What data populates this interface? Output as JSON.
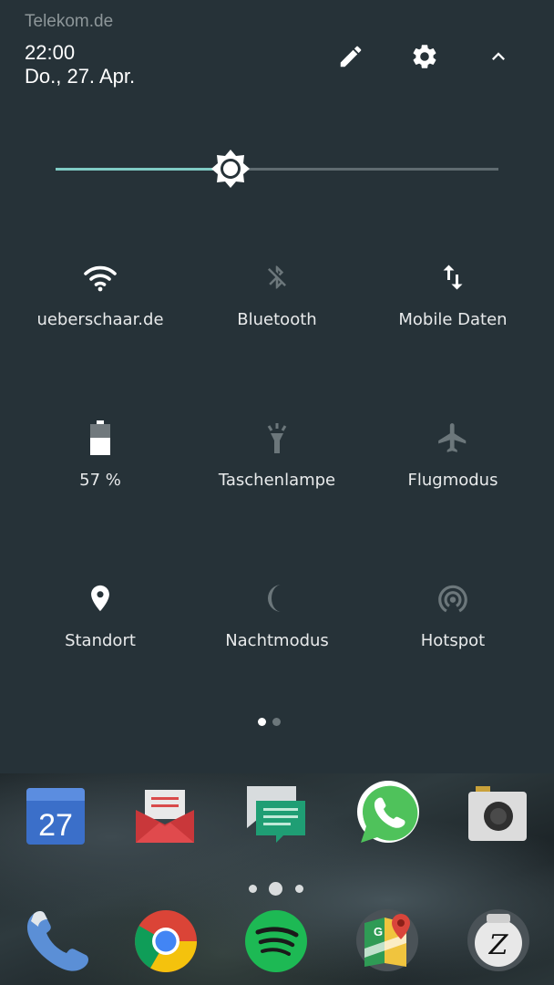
{
  "status": {
    "carrier": "Telekom.de",
    "time": "22:00",
    "date": "Do., 27. Apr."
  },
  "header_icons": [
    "edit-icon",
    "settings-gear-icon",
    "collapse-chevron-icon"
  ],
  "brightness": {
    "level": 0.4
  },
  "tiles": [
    {
      "label": "ueberschaar.de",
      "icon": "wifi-icon",
      "active": true
    },
    {
      "label": "Bluetooth",
      "icon": "bluetooth-off-icon",
      "active": false
    },
    {
      "label": "Mobile Daten",
      "icon": "mobile-data-icon",
      "active": true
    },
    {
      "label": "57 %",
      "icon": "battery-icon",
      "active": true
    },
    {
      "label": "Taschenlampe",
      "icon": "flashlight-icon",
      "active": false
    },
    {
      "label": "Flugmodus",
      "icon": "airplane-icon",
      "active": false
    },
    {
      "label": "Standort",
      "icon": "location-icon",
      "active": true
    },
    {
      "label": "Nachtmodus",
      "icon": "moon-icon",
      "active": false
    },
    {
      "label": "Hotspot",
      "icon": "hotspot-icon",
      "active": false
    }
  ],
  "qs_pages": {
    "count": 2,
    "current": 1
  },
  "home": {
    "calendar_day": "27",
    "dock_apps": [
      "calendar-app-icon",
      "email-app-icon",
      "messages-app-icon",
      "whatsapp-app-icon",
      "camera-app-icon"
    ],
    "bottom_apps": [
      "phone-app-icon",
      "chrome-app-icon",
      "spotify-app-icon",
      "maps-app-icon",
      "zeit-app-icon"
    ],
    "zeit_letter": "Z",
    "page_dots": 3,
    "current_page": 2
  },
  "colors": {
    "panel_bg": "#263238",
    "accent": "#80cbc4",
    "icon_active": "#ffffff",
    "icon_inactive": "#6c777b"
  }
}
